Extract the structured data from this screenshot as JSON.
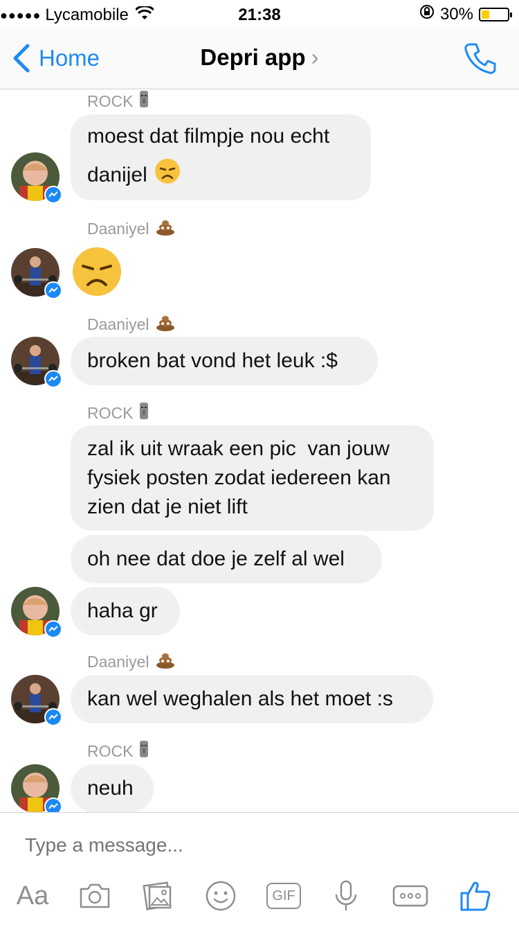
{
  "status_bar": {
    "signal_dots": "●●●●●",
    "carrier": "Lycamobile",
    "time": "21:38",
    "battery_percent": "30%",
    "battery_level": 0.3
  },
  "nav": {
    "back_label": "Home",
    "title": "Depri app",
    "title_chevron": "›"
  },
  "messages": [
    {
      "sender": "ROCK",
      "sender_emoji": "moai"
    },
    {
      "text_1": "moest dat filmpje nou echt",
      "text_2": "danijel"
    },
    {
      "sender": "Daaniyel",
      "sender_emoji": "poop"
    },
    {
      "emoji": "disappointed-face"
    },
    {
      "sender": "Daaniyel",
      "sender_emoji": "poop"
    },
    {
      "text": "broken bat vond het leuk :$"
    },
    {
      "sender": "ROCK",
      "sender_emoji": "moai"
    },
    {
      "lines": [
        "zal ik uit wraak een pic  van jouw",
        "fysiek posten zodat iedereen kan",
        "zien dat je niet lift"
      ]
    },
    {
      "text": "oh nee dat doe je zelf al wel"
    },
    {
      "text": "haha gr"
    },
    {
      "sender": "Daaniyel",
      "sender_emoji": "poop"
    },
    {
      "text": "kan wel weghalen als het moet :s"
    },
    {
      "sender": "ROCK",
      "sender_emoji": "moai"
    },
    {
      "text": "neuh"
    }
  ],
  "composer": {
    "placeholder": "Type a message...",
    "aa_label": "Aa",
    "gif_label": "GIF"
  },
  "colors": {
    "accent": "#1e8bf3",
    "bubble": "#f1f0f0",
    "battery": "#ffcc00"
  }
}
